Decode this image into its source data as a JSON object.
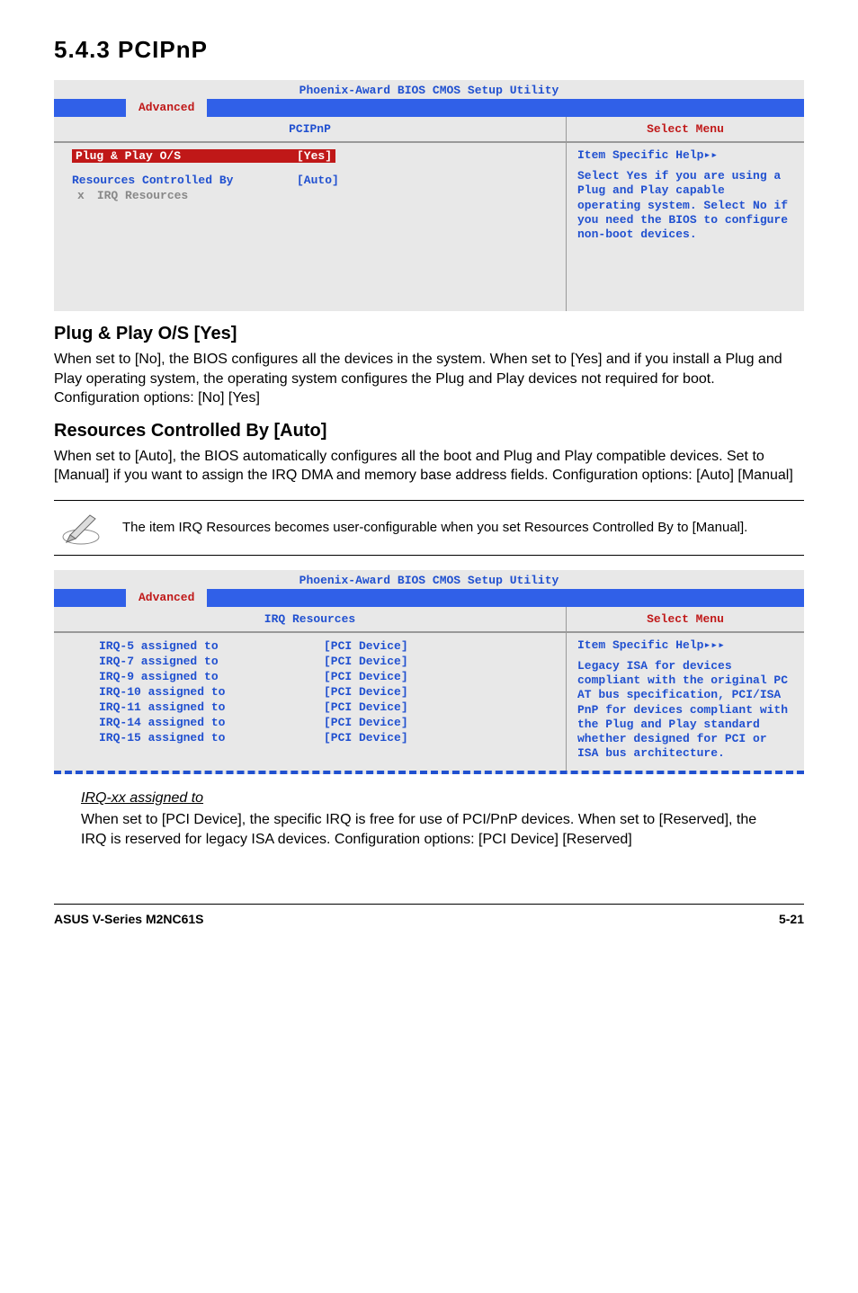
{
  "heading": "5.4.3   PCIPnP",
  "bios1": {
    "title": "Phoenix-Award BIOS CMOS Setup Utility",
    "tab": "Advanced",
    "panel_left_title": "PCIPnP",
    "panel_right_title": "Select Menu",
    "row1_label": "Plug & Play O/S",
    "row1_val": "[Yes]",
    "row2_label": "Resources Controlled By",
    "row2_val": "[Auto]",
    "row3_prefix": "x",
    "row3_label": "IRQ Resources",
    "help_title": "Item Specific Help",
    "help_text": "Select Yes if you are using a Plug and Play capable operating system. Select No if you need the BIOS to configure non-boot devices."
  },
  "section1_title": "Plug & Play O/S [Yes]",
  "section1_body": "When set to [No], the BIOS configures all the devices in the system. When set to [Yes] and if you install a Plug and Play operating system, the operating system configures the Plug and Play devices not required for boot. Configuration options: [No] [Yes]",
  "section2_title": "Resources Controlled By [Auto]",
  "section2_body": "When set to [Auto], the BIOS automatically configures all the boot and Plug and Play compatible devices. Set to [Manual] if you want to assign the IRQ DMA and memory base address fields. Configuration options: [Auto] [Manual]",
  "note_text": "The item IRQ Resources becomes user-configurable when you set Resources Controlled By to [Manual].",
  "bios2": {
    "title": "Phoenix-Award BIOS CMOS Setup Utility",
    "tab": "Advanced",
    "panel_left_title": "IRQ Resources",
    "panel_right_title": "Select Menu",
    "rows": [
      {
        "label": "IRQ-5 assigned to",
        "val": "[PCI Device]"
      },
      {
        "label": "IRQ-7 assigned to",
        "val": "[PCI Device]"
      },
      {
        "label": "IRQ-9 assigned to",
        "val": "[PCI Device]"
      },
      {
        "label": "IRQ-10 assigned to",
        "val": "[PCI Device]"
      },
      {
        "label": "IRQ-11 assigned to",
        "val": "[PCI Device]"
      },
      {
        "label": "IRQ-14 assigned to",
        "val": "[PCI Device]"
      },
      {
        "label": "IRQ-15 assigned to",
        "val": "[PCI Device]"
      }
    ],
    "help_title": "Item Specific Help",
    "help_text": "Legacy ISA for devices compliant with the original PC AT bus specification, PCI/ISA PnP for devices compliant with the Plug and Play standard whether designed for PCI or ISA bus architecture."
  },
  "irq_sub_title": "IRQ-xx assigned to",
  "irq_sub_body": "When set to [PCI Device], the specific IRQ is free for use of PCI/PnP devices. When set to [Reserved], the IRQ is reserved for legacy ISA devices. Configuration options: [PCI Device] [Reserved]",
  "footer_left": "ASUS V-Series M2NC61S",
  "footer_right": "5-21"
}
